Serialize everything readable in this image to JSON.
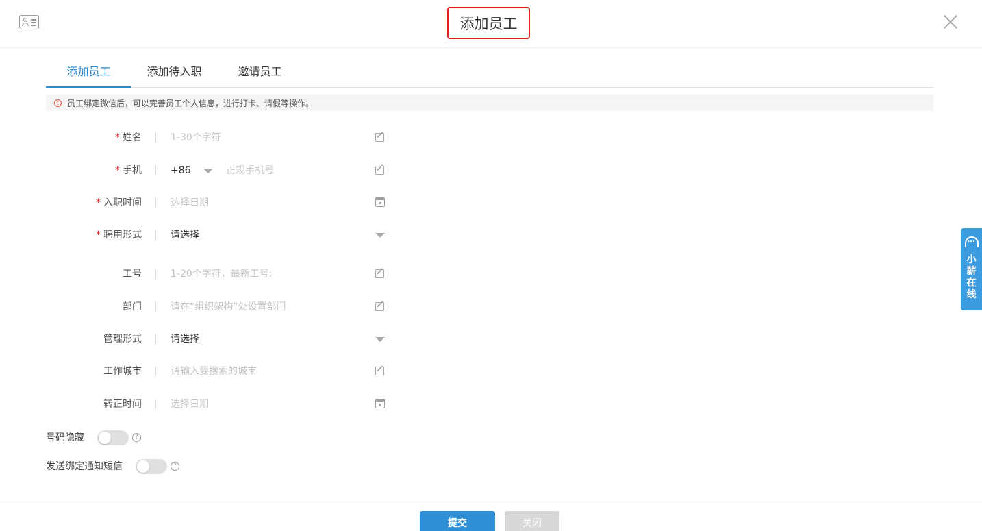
{
  "header": {
    "title": "添加员工"
  },
  "tabs": [
    {
      "label": "添加员工",
      "active": true
    },
    {
      "label": "添加待入职",
      "active": false
    },
    {
      "label": "邀请员工",
      "active": false
    }
  ],
  "notice": {
    "text": "员工绑定微信后，可以完善员工个人信息，进行打卡、请假等操作。",
    "icon": "alert-circle-icon"
  },
  "form": {
    "name": {
      "label": "姓名",
      "placeholder": "1-30个字符"
    },
    "phone": {
      "label": "手机",
      "country_code": "+86",
      "placeholder": "正规手机号"
    },
    "hire_date": {
      "label": "入职时间",
      "placeholder": "选择日期"
    },
    "employment_type": {
      "label": "聘用形式",
      "value": "请选择"
    },
    "employee_no": {
      "label": "工号",
      "placeholder": "1-20个字符，最新工号:"
    },
    "department": {
      "label": "部门",
      "placeholder": "请在“组织架构”处设置部门"
    },
    "management_type": {
      "label": "管理形式",
      "value": "请选择"
    },
    "work_city": {
      "label": "工作城市",
      "placeholder": "请输入要搜索的城市"
    },
    "regular_date": {
      "label": "转正时间",
      "placeholder": "选择日期"
    },
    "required_mark": "*"
  },
  "switches": {
    "hide_number": {
      "label": "号码隐藏",
      "on": false
    },
    "send_sms": {
      "label": "发送绑定通知短信",
      "on": false
    },
    "help_glyph": "?"
  },
  "footer": {
    "submit_label": "提交",
    "close_label": "关闭"
  },
  "side_widget": {
    "label": "小薪在线"
  },
  "colors": {
    "accent": "#2e87c8",
    "required": "#e02020",
    "widget": "#3d9be0"
  }
}
